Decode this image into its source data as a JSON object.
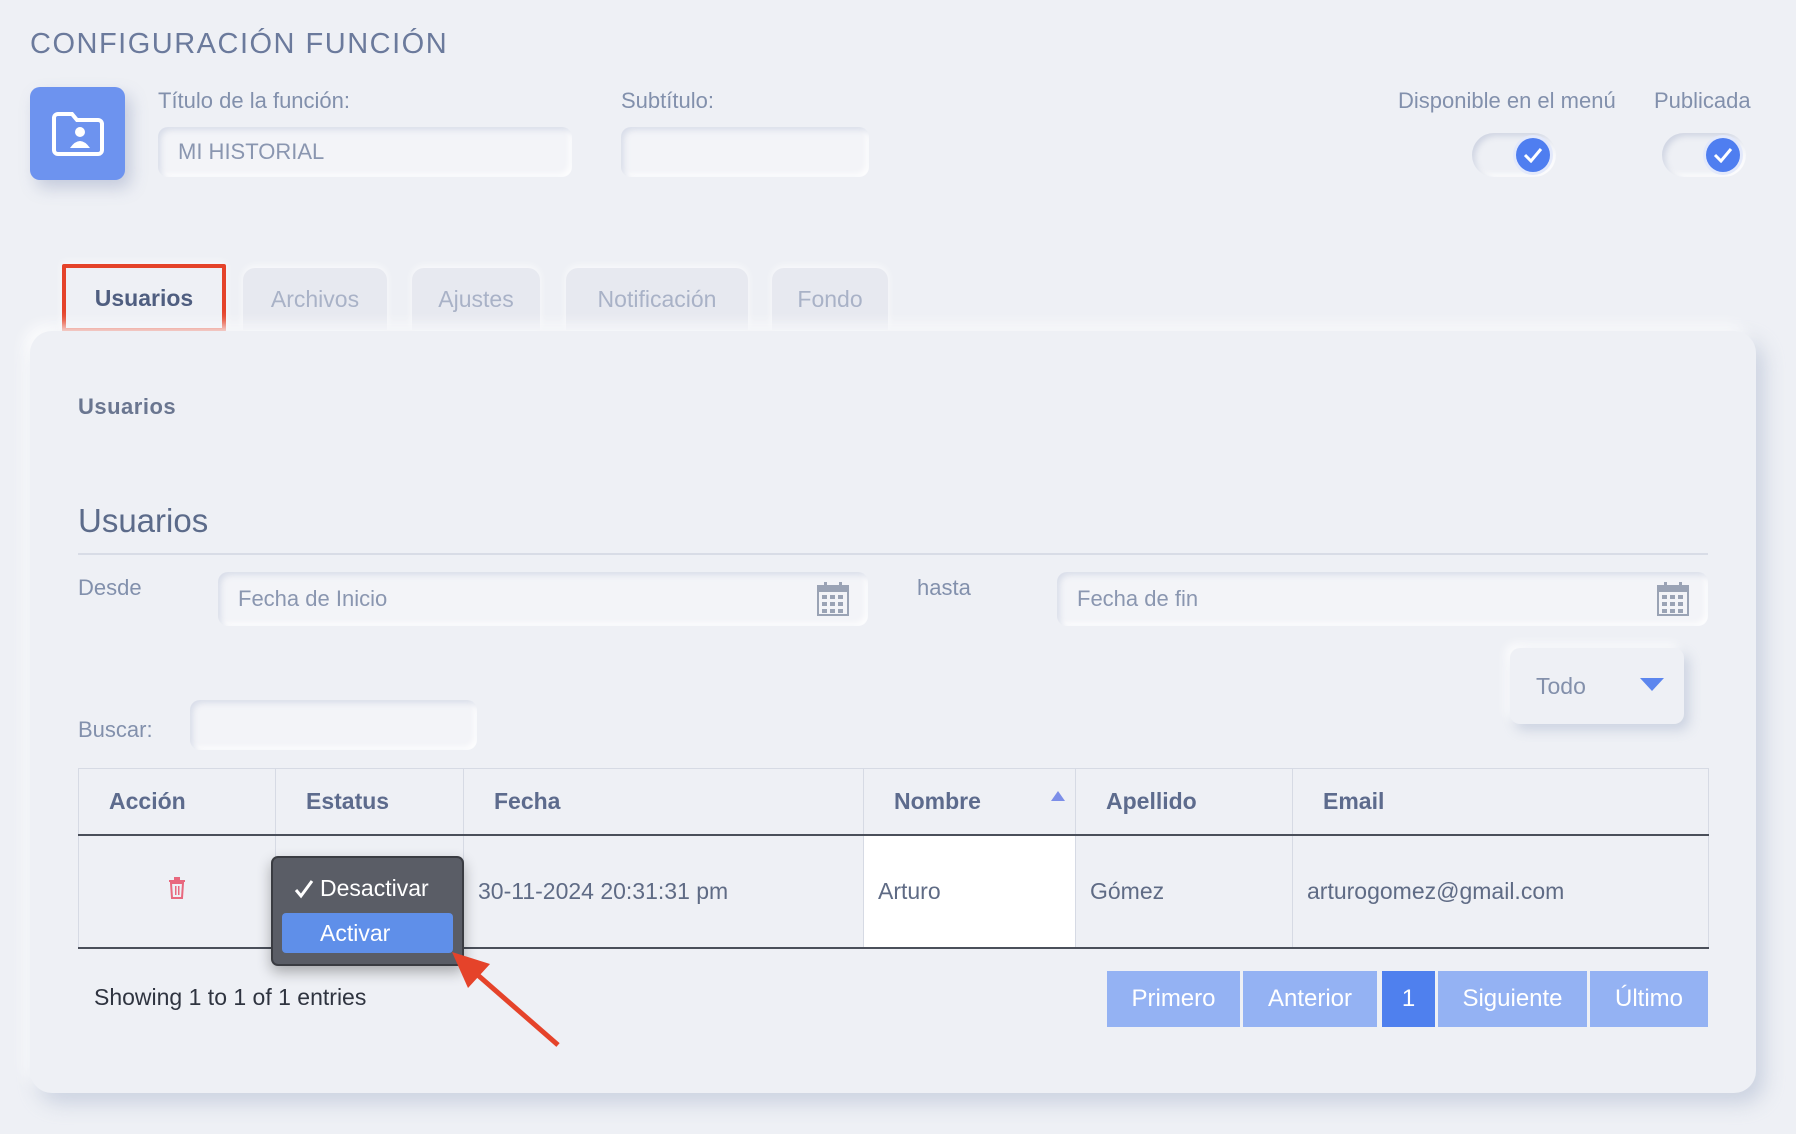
{
  "page": {
    "title": "CONFIGURACIÓN FUNCIÓN"
  },
  "header": {
    "title_label": "Título de la función:",
    "title_value": "MI HISTORIAL",
    "subtitle_label": "Subtítulo:",
    "subtitle_value": "",
    "menu_toggle_label": "Disponible en el menú",
    "menu_toggle_on": true,
    "published_toggle_label": "Publicada",
    "published_toggle_on": true
  },
  "tabs": [
    {
      "label": "Usuarios",
      "active": true
    },
    {
      "label": "Archivos",
      "active": false
    },
    {
      "label": "Ajustes",
      "active": false
    },
    {
      "label": "Notificación",
      "active": false
    },
    {
      "label": "Fondo",
      "active": false
    }
  ],
  "panel": {
    "section_label": "Usuarios",
    "section_title": "Usuarios",
    "filters": {
      "from_label": "Desde",
      "from_placeholder": "Fecha de Inicio",
      "to_label": "hasta",
      "to_placeholder": "Fecha de fin",
      "status_select": "Todo",
      "search_label": "Buscar:",
      "search_value": ""
    },
    "table": {
      "columns": [
        "Acción",
        "Estatus",
        "Fecha",
        "Nombre",
        "Apellido",
        "Email"
      ],
      "sorted_column": "Nombre",
      "rows": [
        {
          "fecha": "30-11-2024 20:31:31 pm",
          "nombre": "Arturo",
          "apellido": "Gómez",
          "email": "arturogomez@gmail.com"
        }
      ]
    },
    "status_dropdown": {
      "options": [
        "Desactivar",
        "Activar"
      ],
      "checked": "Desactivar",
      "highlighted": "Activar"
    },
    "entries_text": "Showing 1 to 1 of 1 entries",
    "pagination": {
      "first": "Primero",
      "prev": "Anterior",
      "current": "1",
      "next": "Siguiente",
      "last": "Último"
    }
  },
  "colors": {
    "accent": "#4f80ee",
    "highlight_box": "#e5432a",
    "delete_icon": "#e8687e",
    "background": "#eef0f5"
  },
  "icons": [
    "folder-user-icon",
    "check-icon",
    "calendar-icon",
    "trash-icon",
    "sort-asc-icon",
    "caret-down-icon"
  ]
}
